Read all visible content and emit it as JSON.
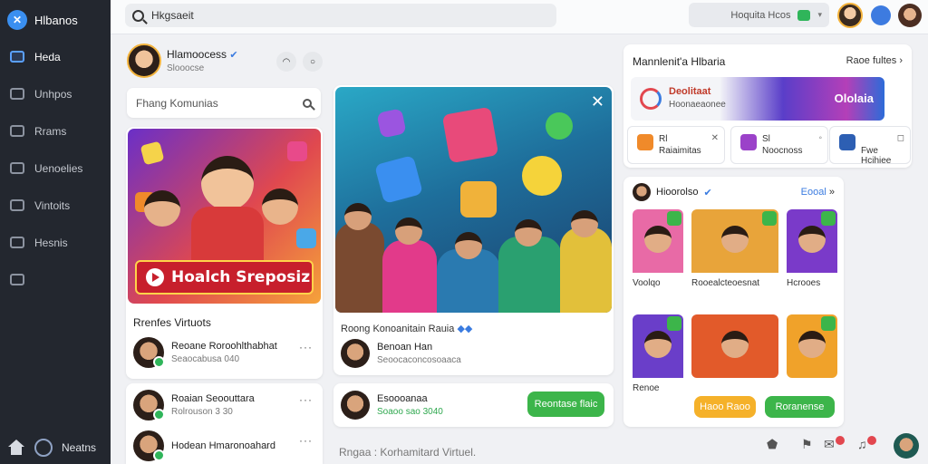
{
  "app": {
    "name": "Hlbanos"
  },
  "sidebar": {
    "items": [
      {
        "label": "Heda",
        "icon": "home-tile-icon",
        "active": true
      },
      {
        "label": "Unhpos",
        "icon": "puzzle-icon"
      },
      {
        "label": "Rrams",
        "icon": "folder-icon"
      },
      {
        "label": "Uenoelies",
        "icon": "pen-icon"
      },
      {
        "label": "Vintoits",
        "icon": "globe-icon"
      },
      {
        "label": "Hesnis",
        "icon": "card-icon"
      },
      {
        "label": "",
        "icon": "building-icon"
      }
    ],
    "footer_label": "Neatns"
  },
  "topbar": {
    "search_text": "Hkgsaeit",
    "pill_label": "Hoquita Hcos"
  },
  "profile": {
    "name": "Hlamoocess",
    "sub": "Slooocse"
  },
  "find": {
    "placeholder": "Fhang Komunias"
  },
  "feature_left": {
    "banner": "Hoalch Sreposiz",
    "section_title": "Rrenfes Virtuots",
    "people": [
      {
        "name": "Reoane Roroohlthabhat",
        "sub": "Seaocabusa 040"
      },
      {
        "name": "Roaian Seoouttara",
        "sub": "Rolrouson 3 30"
      },
      {
        "name": "Hodean Hmaronoahard",
        "sub": ""
      }
    ]
  },
  "feature_mid": {
    "title": "Roong Konoanitain Rauia",
    "person": {
      "name": "Benoan Han",
      "sub": "Seoocaconcosoaaca"
    },
    "card2": {
      "name": "Esoooanaa",
      "sub": "Soaoo sao 3040",
      "button": "Reontase flaic"
    },
    "footer": "Rngaa : Korhamitard Virtuel."
  },
  "right_top": {
    "title": "Mannlenit'a Hlbaria",
    "link": "Raoe fultes",
    "promo": {
      "title": "Deolitaat",
      "sub": "Hoonaeaonee",
      "tag": "Ololaia"
    },
    "minis": [
      {
        "t1": "Rl",
        "t2": "Raiaimitas",
        "color": "#f08a2a"
      },
      {
        "t1": "Sl",
        "t2": "Noocnoss",
        "color": "#9b42c9"
      },
      {
        "t1": "",
        "t2": "Fwe Hcihiee",
        "color": "#2d5fb3"
      }
    ]
  },
  "right_list": {
    "header": "Hioorolso",
    "link": "Eooal",
    "thumbs": [
      {
        "caption": "Voolqo",
        "bg": "#e86aa6"
      },
      {
        "caption": "Rooealcteoesnat",
        "bg": "#e8a43a"
      },
      {
        "caption": "Hcrooes",
        "bg": "#7a3ac9"
      },
      {
        "caption": "Renoe",
        "bg": "#6a3ec9"
      },
      {
        "caption": "",
        "bg": "#e25a2a"
      },
      {
        "caption": "",
        "bg": "#f0a22a"
      }
    ],
    "button_orange": "Haoo Raoo",
    "button_green": "Roranense"
  },
  "colors": {
    "accent_blue": "#3a7be0",
    "accent_green": "#3cb54a",
    "accent_orange": "#f5b12a",
    "sidebar_bg": "#23272f"
  }
}
